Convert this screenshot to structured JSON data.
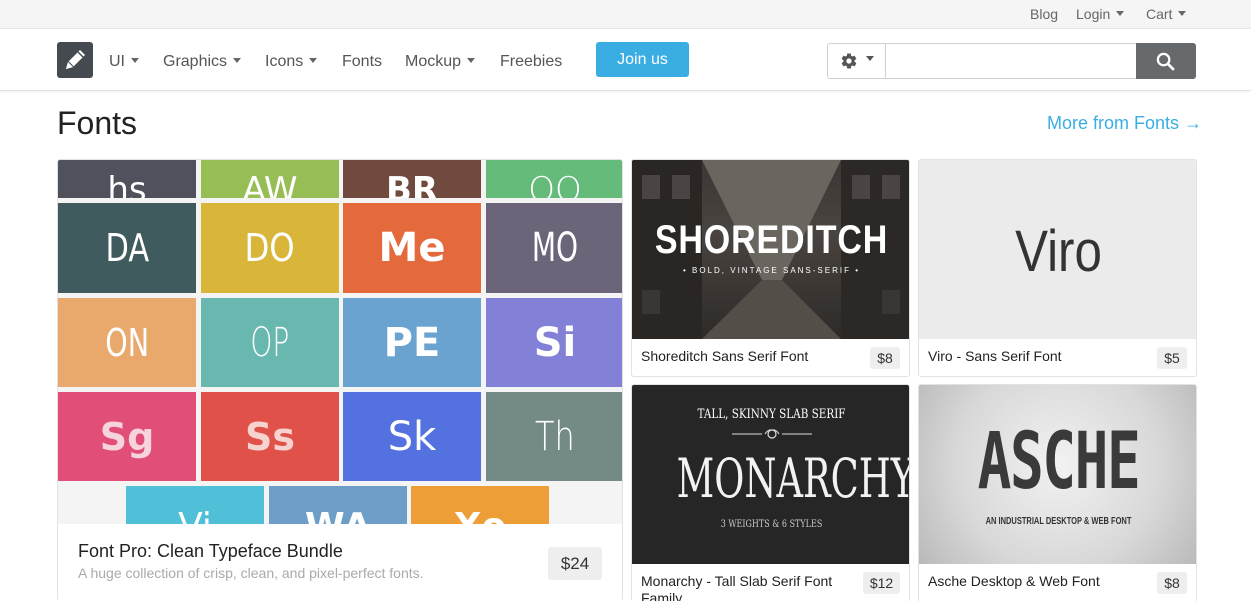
{
  "topbar": {
    "blog": "Blog",
    "login": "Login",
    "cart": "Cart"
  },
  "nav": {
    "logo_icon": "pencil-icon",
    "items": [
      {
        "label": "UI",
        "dropdown": true
      },
      {
        "label": "Graphics",
        "dropdown": true
      },
      {
        "label": "Icons",
        "dropdown": true
      },
      {
        "label": "Fonts",
        "dropdown": false
      },
      {
        "label": "Mockup",
        "dropdown": true
      },
      {
        "label": "Freebies",
        "dropdown": false
      }
    ],
    "join_label": "Join us",
    "search": {
      "placeholder": "",
      "value": "",
      "settings_icon": "gear-icon",
      "button_icon": "search-icon"
    }
  },
  "section": {
    "title": "Fonts",
    "more_link": "More from Fonts →"
  },
  "featured": {
    "title": "Font Pro: Clean Typeface Bundle",
    "subtitle": "A huge collection of crisp, clean, and pixel-perfect fonts.",
    "price": "$24",
    "tiles_row0": [
      "hs",
      "AW",
      "BR",
      "OO"
    ],
    "tiles_row1": [
      "DA",
      "DO",
      "Me",
      "MO"
    ],
    "tiles_row2": [
      "ON",
      "OP",
      "PE",
      "Si"
    ],
    "tiles_row3": [
      "Sg",
      "Ss",
      "Sk",
      "Th"
    ],
    "tiles_row4": [
      "Vi",
      "WA",
      "Xo"
    ]
  },
  "products": [
    {
      "title": "Shoreditch Sans Serif Font",
      "price": "$8",
      "art_title": "SHOREDITCH",
      "art_sub": "• BOLD, VINTAGE SANS-SERIF •"
    },
    {
      "title": "Viro - Sans Serif Font",
      "price": "$5",
      "art_title": "Viro"
    },
    {
      "title": "Monarchy - Tall Slab Serif Font Family",
      "price": "$12",
      "art_top": "TALL, SKINNY SLAB SERIF",
      "art_title": "MONARCHY",
      "art_sub": "3 WEIGHTS & 6 STYLES"
    },
    {
      "title": "Asche Desktop & Web Font",
      "price": "$8",
      "art_title": "ASCHE",
      "art_sub": "AN INDUSTRIAL DESKTOP & WEB FONT"
    }
  ],
  "colors": {
    "accent": "#3aaee3",
    "search_button": "#666a6d"
  }
}
